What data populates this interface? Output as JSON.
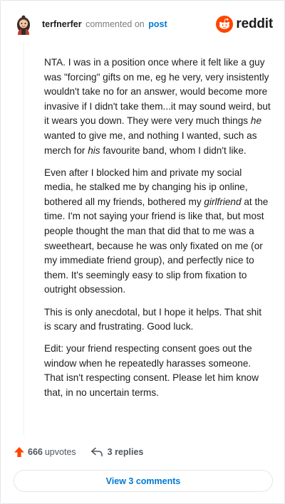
{
  "header": {
    "username": "terfnerfer",
    "action_text": "commented on",
    "post_link": "post",
    "brand_name": "reddit"
  },
  "comment": {
    "paragraphs": [
      [
        {
          "text": "NTA. I was in a position once where it felt like a guy was \"forcing\" gifts on me, eg he very, very insistently wouldn't take no for an answer, would become more invasive if I didn't take them...it may sound weird, but it wears you down. They were very much things "
        },
        {
          "text": "he",
          "em": true
        },
        {
          "text": " wanted to give me, and nothing I wanted, such as merch for "
        },
        {
          "text": "his",
          "em": true
        },
        {
          "text": " favourite band, whom I didn't like."
        }
      ],
      [
        {
          "text": "Even after I blocked him and private my social media, he stalked me by changing his ip online, bothered all my friends, bothered my "
        },
        {
          "text": "girlfriend",
          "em": true
        },
        {
          "text": " at the time. I'm not saying your friend is like that, but most people thought the man that did that to me was a sweetheart, because he was only fixated on me (or my immediate friend group), and perfectly nice to them. It's seemingly easy to slip from fixation to outright obsession."
        }
      ],
      [
        {
          "text": "This is only anecdotal, but I hope it helps. That shit is scary and frustrating. Good luck."
        }
      ],
      [
        {
          "text": "Edit: your friend respecting consent goes out the window when he repeatedly harasses someone. That isn't respecting consent. Please let him know that, in no uncertain terms."
        }
      ]
    ]
  },
  "footer": {
    "upvote_count": "666",
    "upvote_label": "upvotes",
    "replies_label": "3 replies",
    "view_comments_label": "View 3 comments"
  },
  "colors": {
    "accent_blue": "#0079d3",
    "upvote_orange": "#ff4500",
    "text": "#1c1c1c",
    "muted": "#7c7c7c"
  },
  "icons": {
    "avatar": "user-avatar",
    "brand": "reddit-snoo-icon",
    "upvote": "upvote-arrow-icon",
    "reply": "reply-arrow-icon"
  }
}
